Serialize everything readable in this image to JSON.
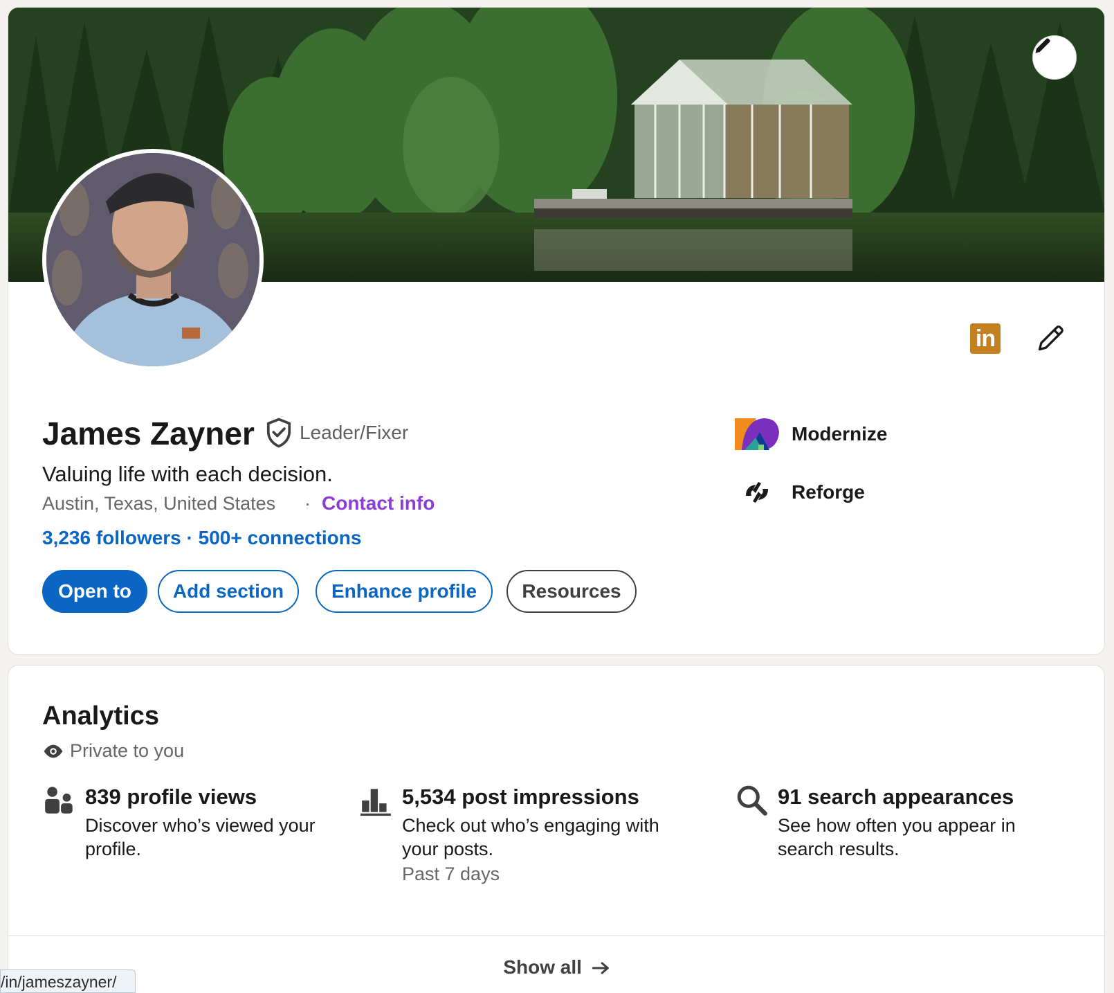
{
  "profile": {
    "name": "James Zayner",
    "pronoun_label": "Leader/Fixer",
    "headline": "Valuing life with each decision.",
    "location": "Austin, Texas, United States",
    "separator": "·",
    "contact_info": "Contact info",
    "followers": "3,236 followers",
    "network_separator": " · ",
    "connections": "500+ connections",
    "buttons": {
      "open_to": "Open to",
      "add_section": "Add section",
      "enhance_profile": "Enhance profile",
      "resources": "Resources"
    },
    "companies": [
      {
        "name": "Modernize",
        "icon": "modernize-logo"
      },
      {
        "name": "Reforge",
        "icon": "reforge-logo"
      }
    ],
    "icons": {
      "banner_edit": "pencil-icon",
      "linkedin": "linkedin-icon",
      "intro_edit": "pencil-icon",
      "verified": "shield-check-icon"
    },
    "linkedin_text": "in"
  },
  "analytics": {
    "title": "Analytics",
    "privacy": "Private to you",
    "metrics": [
      {
        "title": "839 profile views",
        "description": "Discover who’s viewed your profile.",
        "icon": "people-icon"
      },
      {
        "title": "5,534 post impressions",
        "description": "Check out who’s engaging with your posts.",
        "period": "Past 7 days",
        "icon": "bar-chart-icon"
      },
      {
        "title": "91 search appearances",
        "description": "See how often you appear in search results.",
        "icon": "search-icon"
      }
    ],
    "show_all": "Show all"
  },
  "status_bar": {
    "url": "/in/jameszayner/"
  },
  "colors": {
    "primary": "#0a66c2",
    "contact": "#8b3dd6",
    "linkedin_badge": "#c47f1e"
  }
}
